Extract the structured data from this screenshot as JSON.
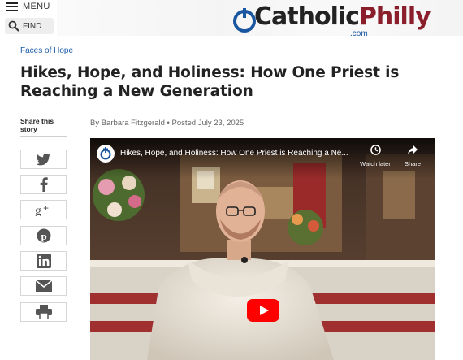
{
  "header": {
    "menu_label": "MENU",
    "find_label": "FIND",
    "logo": {
      "catholic": "Catholic",
      "philly": "Philly",
      "dotcom": ".com"
    }
  },
  "article": {
    "category": "Faces of Hope",
    "title": "Hikes, Hope, and Holiness: How One Priest is Reaching a New Generation",
    "byline": "By Barbara Fitzgerald • Posted July 23, 2025"
  },
  "share": {
    "label": "Share this story",
    "buttons": [
      "twitter-icon",
      "facebook-icon",
      "google-plus-icon",
      "pinterest-icon",
      "linkedin-icon",
      "email-icon",
      "print-icon"
    ]
  },
  "video": {
    "title": "Hikes, Hope, and Holiness: How One Priest is Reaching a Ne...",
    "watch_later": "Watch later",
    "share": "Share"
  },
  "colors": {
    "link_blue": "#1a5aa8",
    "logo_red": "#8a1f2b",
    "youtube_red": "#ff0000"
  }
}
